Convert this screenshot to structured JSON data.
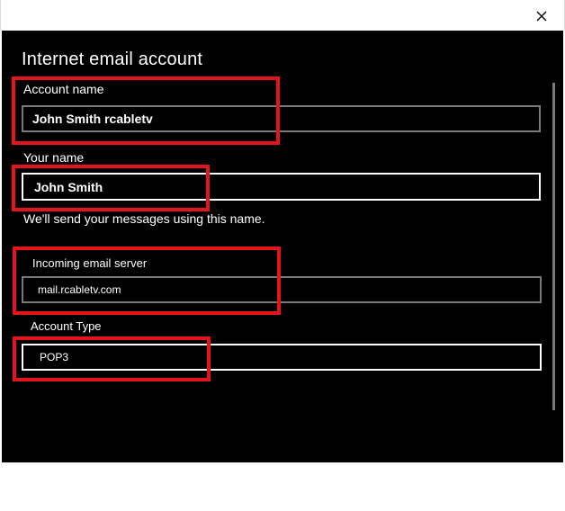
{
  "window": {
    "close_icon": "close-icon"
  },
  "dialog": {
    "title": "Internet email account",
    "account_name": {
      "label": "Account name",
      "value": "John Smith rcabletv"
    },
    "your_name": {
      "label": "Your name",
      "value": "John Smith",
      "hint": "We'll send your messages using this name."
    },
    "incoming_server": {
      "label": "Incoming email server",
      "value": "mail.rcabletv.com"
    },
    "account_type": {
      "label": "Account Type",
      "value": "POP3"
    }
  },
  "colors": {
    "background": "#000000",
    "text": "#ffffff",
    "highlight": "#e3141b",
    "field_border_inactive": "#7a7a7a"
  }
}
